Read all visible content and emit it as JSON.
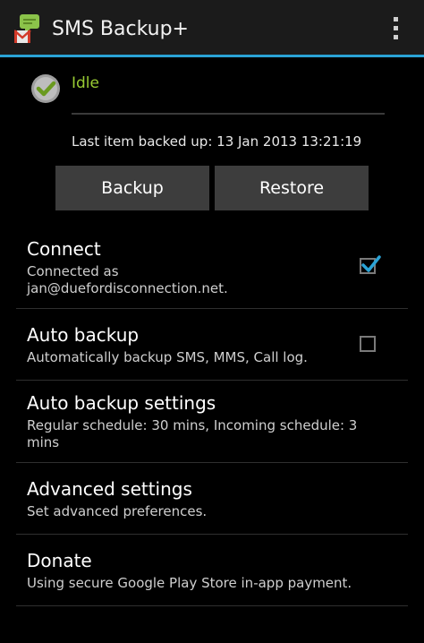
{
  "app": {
    "title": "SMS Backup+",
    "accent_color": "#2aa3d6",
    "icon": "sms-backup-app-icon",
    "overflow_icon": "overflow-menu-icon"
  },
  "status": {
    "icon": "check-circle-icon",
    "text": "Idle",
    "color": "#99cc33",
    "last_backup": "Last item backed up: 13 Jan 2013 13:21:19"
  },
  "buttons": {
    "backup_label": "Backup",
    "restore_label": "Restore"
  },
  "preferences": [
    {
      "title": "Connect",
      "summary": "Connected as jan@duefordisconnection.net.",
      "checkbox": true,
      "checked": true
    },
    {
      "title": "Auto backup",
      "summary": "Automatically backup SMS, MMS, Call log.",
      "checkbox": true,
      "checked": false
    },
    {
      "title": "Auto backup settings",
      "summary": "Regular schedule: 30 mins, Incoming schedule: 3 mins",
      "checkbox": false
    },
    {
      "title": "Advanced settings",
      "summary": "Set advanced preferences.",
      "checkbox": false
    },
    {
      "title": "Donate",
      "summary": "Using secure Google Play Store in-app payment.",
      "checkbox": false
    }
  ]
}
